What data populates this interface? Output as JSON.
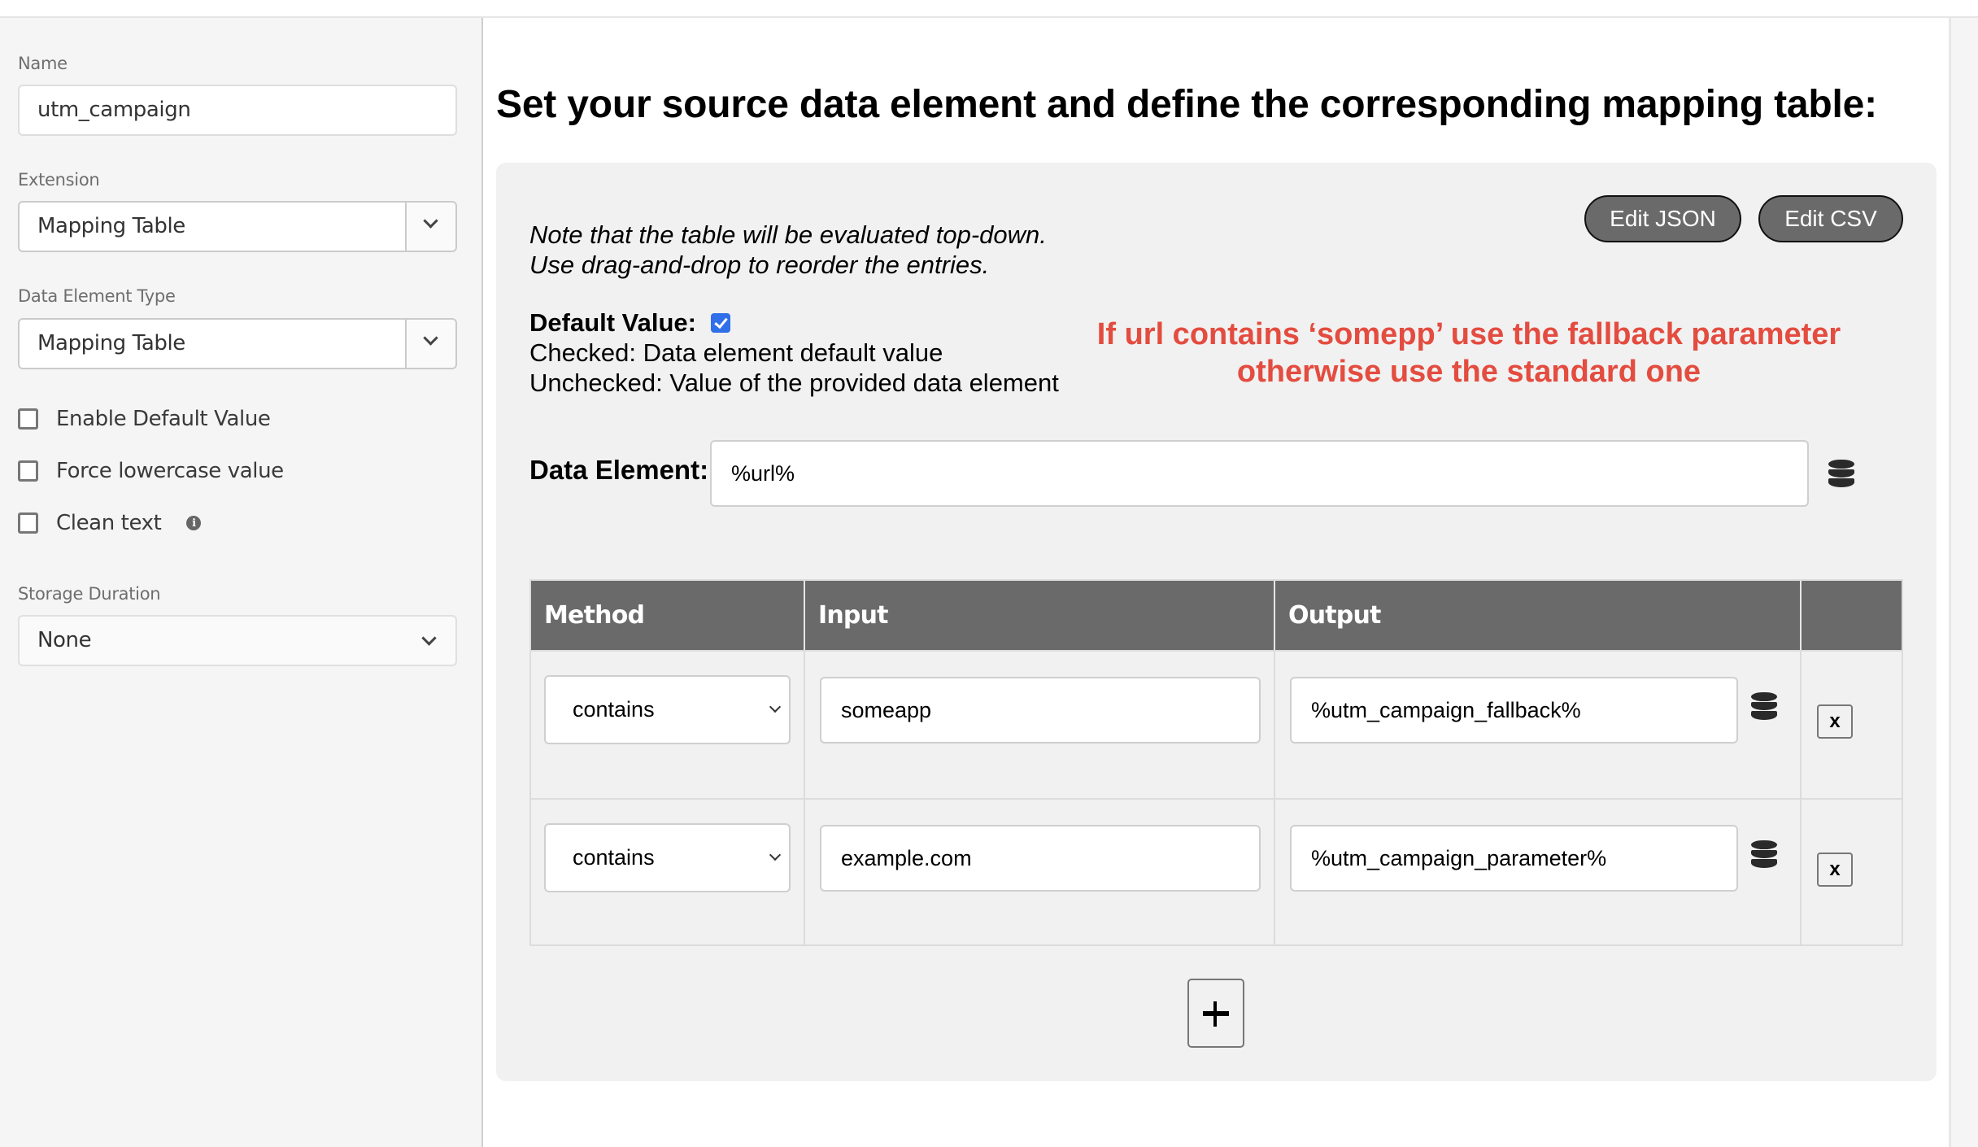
{
  "sidebar": {
    "name": {
      "label": "Name",
      "value": "utm_campaign"
    },
    "extension": {
      "label": "Extension",
      "value": "Mapping Table"
    },
    "data_element_type": {
      "label": "Data Element Type",
      "value": "Mapping Table"
    },
    "checkboxes": [
      {
        "label": "Enable Default Value",
        "checked": false
      },
      {
        "label": "Force lowercase value",
        "checked": false
      },
      {
        "label": "Clean text",
        "checked": false,
        "info_icon": "info-icon"
      }
    ],
    "storage_duration": {
      "label": "Storage Duration",
      "value": "None"
    }
  },
  "main": {
    "title": "Set your source data element and define the corresponding mapping table:",
    "buttons": {
      "edit_json": "Edit JSON",
      "edit_csv": "Edit CSV"
    },
    "note": {
      "line1": "Note that the table will be evaluated top-down.",
      "line2": "Use drag-and-drop to reorder the entries."
    },
    "default_value": {
      "label": "Default Value:",
      "checked": true,
      "checked_desc": "Checked: Data element default value",
      "unchecked_desc": "Unchecked: Value of the provided data element"
    },
    "annotation": {
      "line1": "If url contains ‘somepp’ use the fallback parameter",
      "line2": "otherwise use the standard one",
      "color": "#e34c3f"
    },
    "data_element": {
      "label": "Data Element:",
      "value": "%url%",
      "icon": "database-icon"
    },
    "table": {
      "headers": [
        "Method",
        "Input",
        "Output",
        ""
      ],
      "rows": [
        {
          "method": "contains",
          "input": "someapp",
          "output": "%utm_campaign_fallback%",
          "remove": "x"
        },
        {
          "method": "contains",
          "input": "example.com",
          "output": "%utm_campaign_parameter%",
          "remove": "x"
        }
      ]
    },
    "add_button": "+"
  },
  "colors": {
    "header_bg": "#6a6a6a",
    "panel_bg": "#f1f1f1",
    "sidebar_bg": "#f5f5f5",
    "checkbox_accent": "#2f6fea"
  }
}
